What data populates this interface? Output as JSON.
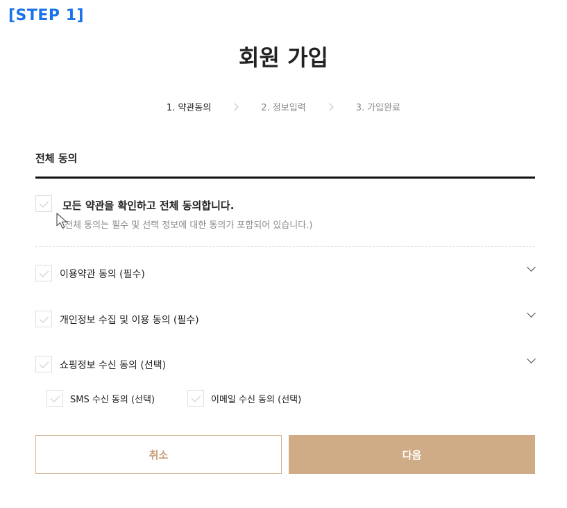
{
  "step_tag": "[STEP 1]",
  "page_title": "회원 가입",
  "steps": [
    {
      "label": "1. 약관동의",
      "active": true
    },
    {
      "label": "2. 정보입력",
      "active": false
    },
    {
      "label": "3. 가입완료",
      "active": false
    }
  ],
  "section_title": "전체 동의",
  "agree_all": {
    "label": "모든 약관을 확인하고 전체 동의합니다.",
    "description": "(전체 동의는 필수 및 선택 정보에 대한 동의가 포함되어 있습니다.)",
    "checked": false
  },
  "terms": [
    {
      "label": "이용약관 동의 (필수)",
      "checked": false
    },
    {
      "label": "개인정보 수집 및 이용 동의 (필수)",
      "checked": false
    },
    {
      "label": "쇼핑정보 수신 동의 (선택)",
      "checked": false
    }
  ],
  "sub_options": [
    {
      "label": "SMS 수신 동의 (선택)",
      "checked": false
    },
    {
      "label": "이메일 수신 동의 (선택)",
      "checked": false
    }
  ],
  "buttons": {
    "cancel": "취소",
    "next": "다음"
  },
  "colors": {
    "accent": "#cfab86",
    "step_tag": "#1a73e8"
  }
}
